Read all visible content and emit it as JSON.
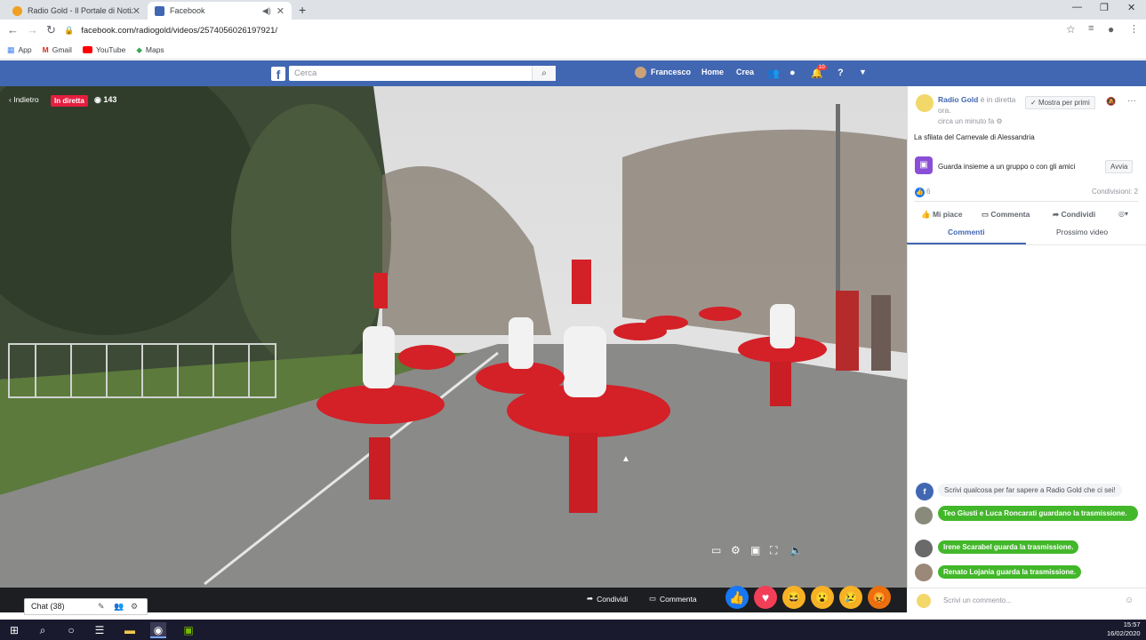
{
  "browser": {
    "tabs": [
      {
        "title": "Radio Gold - Il Portale di Notizie"
      },
      {
        "title": "Facebook"
      }
    ],
    "url": "facebook.com/radiogold/videos/2574056026197921/",
    "bookmarks": [
      {
        "label": "App"
      },
      {
        "label": "Gmail"
      },
      {
        "label": "YouTube"
      },
      {
        "label": "Maps"
      }
    ]
  },
  "fb_header": {
    "search_placeholder": "Cerca",
    "user": "Francesco",
    "home": "Home",
    "create": "Crea",
    "notifications_count": "10"
  },
  "video": {
    "back": "Indietro",
    "live_badge": "In diretta",
    "viewers": "143",
    "chat_label": "Chat (38)",
    "share": "Condividi",
    "comment": "Commenta"
  },
  "sidebar": {
    "page_name": "Radio Gold",
    "status": "è in diretta ora.",
    "time": "circa un minuto fa",
    "follow": "Mostra per primi",
    "description": "La sfilata del Carnevale di Alessandria",
    "watch_together": "Guarda insieme a un gruppo o con gli amici",
    "start": "Avvia",
    "reactions_count": "6",
    "shares": "Condivisioni: 2",
    "like": "Mi piace",
    "comment": "Commenta",
    "share": "Condividi",
    "tab_comments": "Commenti",
    "tab_next": "Prossimo video",
    "prompt": "Scrivi qualcosa per far sapere a Radio Gold che ci sei!",
    "comments": [
      {
        "text": "Teo Giusti e Luca Roncarati guardano la trasmissione."
      },
      {
        "text": "Irene Scarabel guarda la trasmissione."
      },
      {
        "text": "Renato Lojania guarda la trasmissione."
      }
    ],
    "comment_placeholder": "Scrivi un commento..."
  },
  "taskbar": {
    "time": "15:57",
    "date": "16/02/2020"
  },
  "colors": {
    "fb_blue": "#4267b2",
    "live_red": "#e41e3f",
    "green": "#42b72a"
  }
}
